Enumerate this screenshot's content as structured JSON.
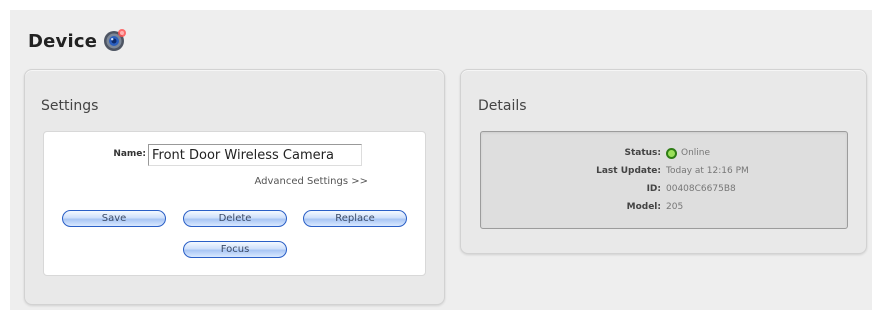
{
  "header": {
    "title": "Device",
    "icon": "camera-icon"
  },
  "settings": {
    "title": "Settings",
    "name_label": "Name:",
    "name_value": "Front Door Wireless Camera",
    "advanced_link": "Advanced Settings >>",
    "buttons": {
      "save": "Save",
      "delete": "Delete",
      "replace": "Replace",
      "focus": "Focus"
    }
  },
  "details": {
    "title": "Details",
    "status_label": "Status:",
    "status_value": "Online",
    "status_color": "#5cc228",
    "last_update_label": "Last Update:",
    "last_update_value": "Today at 12:16 PM",
    "id_label": "ID:",
    "id_value": "00408C6675B8",
    "model_label": "Model:",
    "model_value": "205"
  }
}
